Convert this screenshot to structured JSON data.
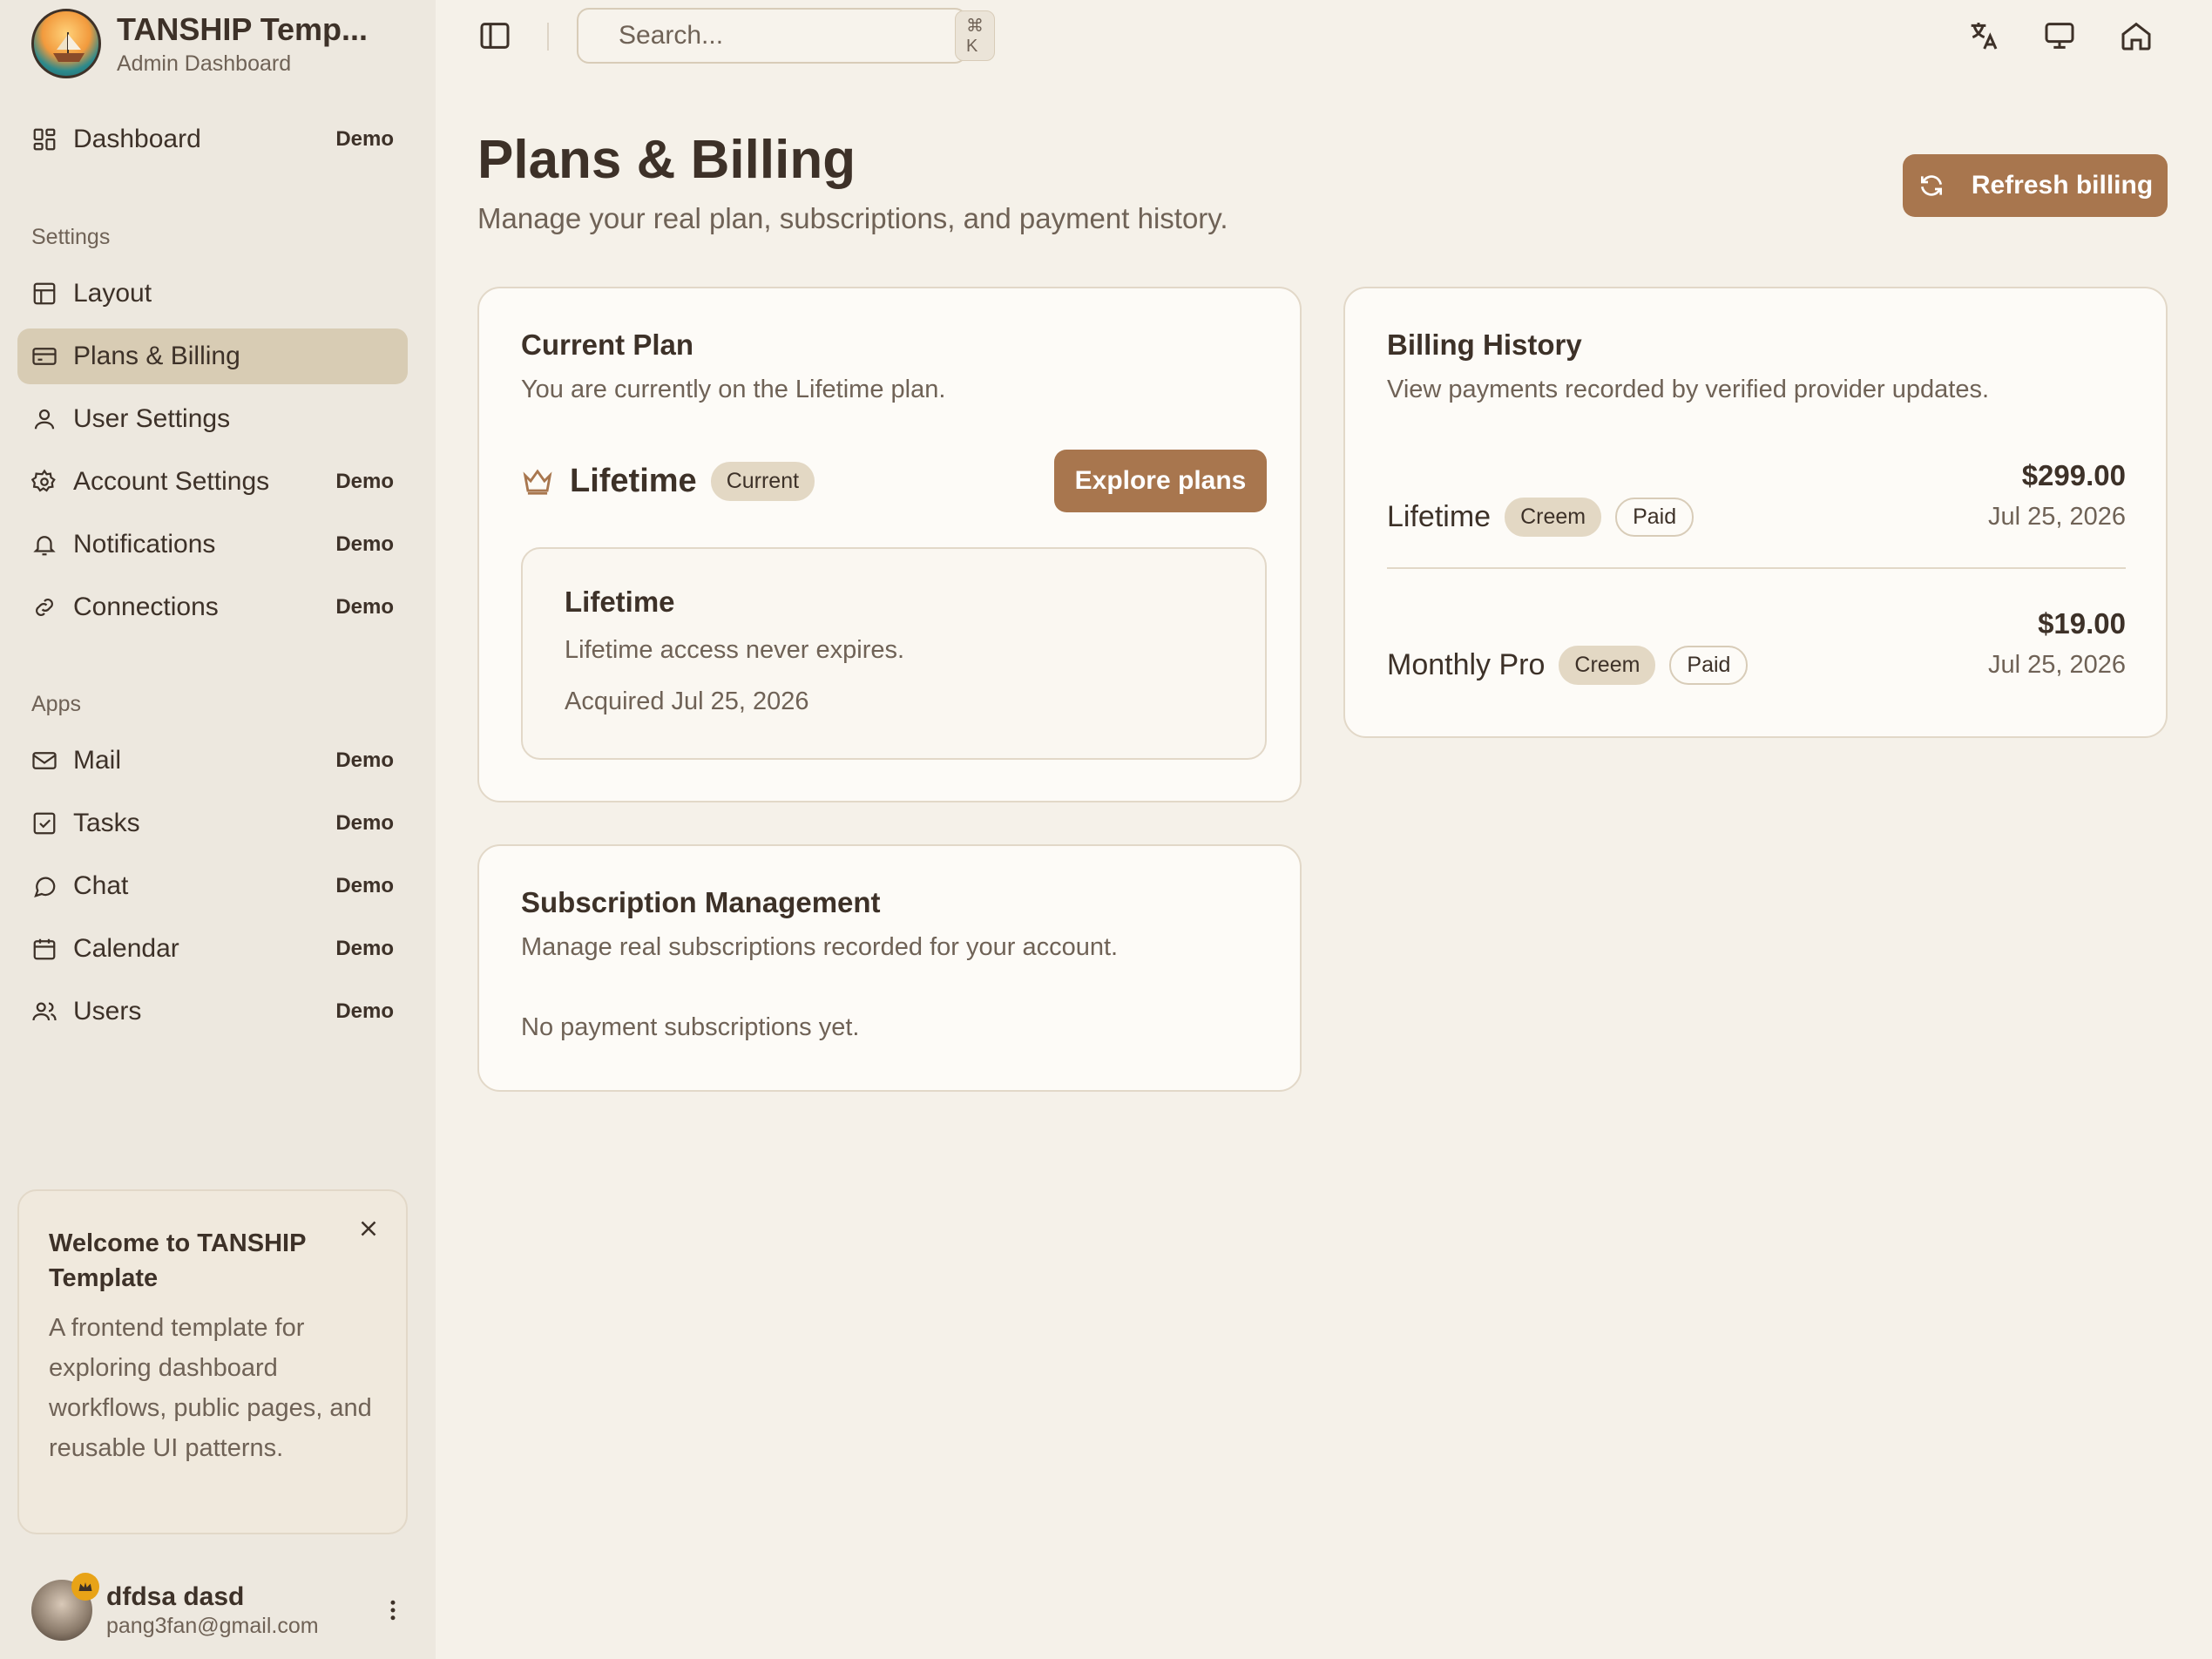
{
  "brand": {
    "title": "TANSHIP Temp...",
    "subtitle": "Admin Dashboard"
  },
  "nav": {
    "dashboard": {
      "label": "Dashboard",
      "badge": "Demo"
    },
    "settings_label": "Settings",
    "settings": [
      {
        "label": "Layout",
        "badge": ""
      },
      {
        "label": "Plans & Billing",
        "badge": ""
      },
      {
        "label": "User Settings",
        "badge": ""
      },
      {
        "label": "Account Settings",
        "badge": "Demo"
      },
      {
        "label": "Notifications",
        "badge": "Demo"
      },
      {
        "label": "Connections",
        "badge": "Demo"
      }
    ],
    "apps_label": "Apps",
    "apps": [
      {
        "label": "Mail",
        "badge": "Demo"
      },
      {
        "label": "Tasks",
        "badge": "Demo"
      },
      {
        "label": "Chat",
        "badge": "Demo"
      },
      {
        "label": "Calendar",
        "badge": "Demo"
      },
      {
        "label": "Users",
        "badge": "Demo"
      }
    ]
  },
  "welcome": {
    "title": "Welcome to TANSHIP Template",
    "text": "A frontend template for exploring dashboard workflows, public pages, and reusable UI patterns."
  },
  "user": {
    "name": "dfdsa dasd",
    "email": "pang3fan@gmail.com"
  },
  "topbar": {
    "search_placeholder": "Search...",
    "search_shortcut": "⌘ K"
  },
  "page": {
    "title": "Plans & Billing",
    "subtitle": "Manage your real plan, subscriptions, and payment history.",
    "refresh_label": "Refresh billing"
  },
  "current_plan": {
    "title": "Current Plan",
    "description": "You are currently on the Lifetime plan.",
    "plan_name": "Lifetime",
    "status_pill": "Current",
    "explore_label": "Explore plans",
    "detail_title": "Lifetime",
    "detail_text": "Lifetime access never expires.",
    "acquired": "Acquired Jul 25, 2026"
  },
  "subscriptions": {
    "title": "Subscription Management",
    "description": "Manage real subscriptions recorded for your account.",
    "empty": "No payment subscriptions yet."
  },
  "billing_history": {
    "title": "Billing History",
    "description": "View payments recorded by verified provider updates.",
    "rows": [
      {
        "plan": "Lifetime",
        "provider": "Creem",
        "status": "Paid",
        "amount": "$299.00",
        "date": "Jul 25, 2026"
      },
      {
        "plan": "Monthly Pro",
        "provider": "Creem",
        "status": "Paid",
        "amount": "$19.00",
        "date": "Jul 25, 2026"
      }
    ]
  },
  "colors": {
    "accent": "#a8764e",
    "active_nav": "#d8ccb4",
    "background": "#f5f1e9",
    "sidebar": "#ede8df"
  }
}
